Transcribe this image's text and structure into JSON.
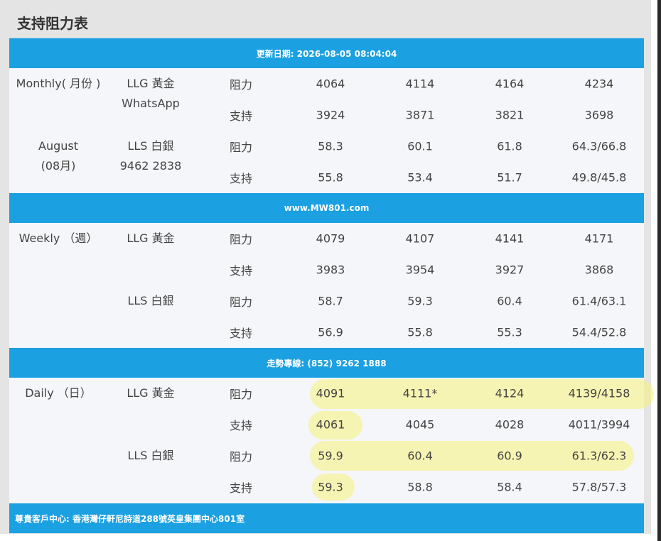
{
  "title": "支持阻力表",
  "bands": {
    "updated": "更新日期: 2026-08-05 08:04:04",
    "website": "www.MW801.com",
    "hotline": "走勢專線: (852) 9262 1888",
    "address": "尊貴客戶中心: 香港灣仔軒尼詩道288號英皇集團中心801室"
  },
  "monthly": {
    "period_line1": "Monthly( 月份 )",
    "period_line2": "August",
    "period_line3": "(08月)",
    "gold": "LLG 黃金",
    "whatsapp_label": "WhatsApp",
    "silver": "LLS 白銀",
    "whatsapp_number": "9462 2838",
    "rows": [
      {
        "type": "阻力",
        "v": [
          "4064",
          "4114",
          "4164",
          "4234"
        ]
      },
      {
        "type": "支持",
        "v": [
          "3924",
          "3871",
          "3821",
          "3698"
        ]
      },
      {
        "type": "阻力",
        "v": [
          "58.3",
          "60.1",
          "61.8",
          "64.3/66.8"
        ]
      },
      {
        "type": "支持",
        "v": [
          "55.8",
          "53.4",
          "51.7",
          "49.8/45.8"
        ]
      }
    ]
  },
  "weekly": {
    "period": "Weekly （週）",
    "gold": "LLG 黃金",
    "silver": "LLS 白銀",
    "rows": [
      {
        "type": "阻力",
        "v": [
          "4079",
          "4107",
          "4141",
          "4171"
        ]
      },
      {
        "type": "支持",
        "v": [
          "3983",
          "3954",
          "3927",
          "3868"
        ]
      },
      {
        "type": "阻力",
        "v": [
          "58.7",
          "59.3",
          "60.4",
          "61.4/63.1"
        ]
      },
      {
        "type": "支持",
        "v": [
          "56.9",
          "55.8",
          "55.3",
          "54.4/52.8"
        ]
      }
    ]
  },
  "daily": {
    "period": "Daily （日）",
    "gold": "LLG 黃金",
    "silver": "LLS 白銀",
    "rows": [
      {
        "type": "阻力",
        "v": [
          "4091",
          "4111*",
          "4124",
          "4139/4158"
        ]
      },
      {
        "type": "支持",
        "v": [
          "4061",
          "4045",
          "4028",
          "4011/3994"
        ]
      },
      {
        "type": "阻力",
        "v": [
          "59.9",
          "60.4",
          "60.9",
          "61.3/62.3"
        ]
      },
      {
        "type": "支持",
        "v": [
          "59.3",
          "58.8",
          "58.4",
          "57.8/57.3"
        ]
      }
    ]
  },
  "colors": {
    "band": "#1ba0e2",
    "highlight": "#f8f378",
    "text": "#444444"
  }
}
